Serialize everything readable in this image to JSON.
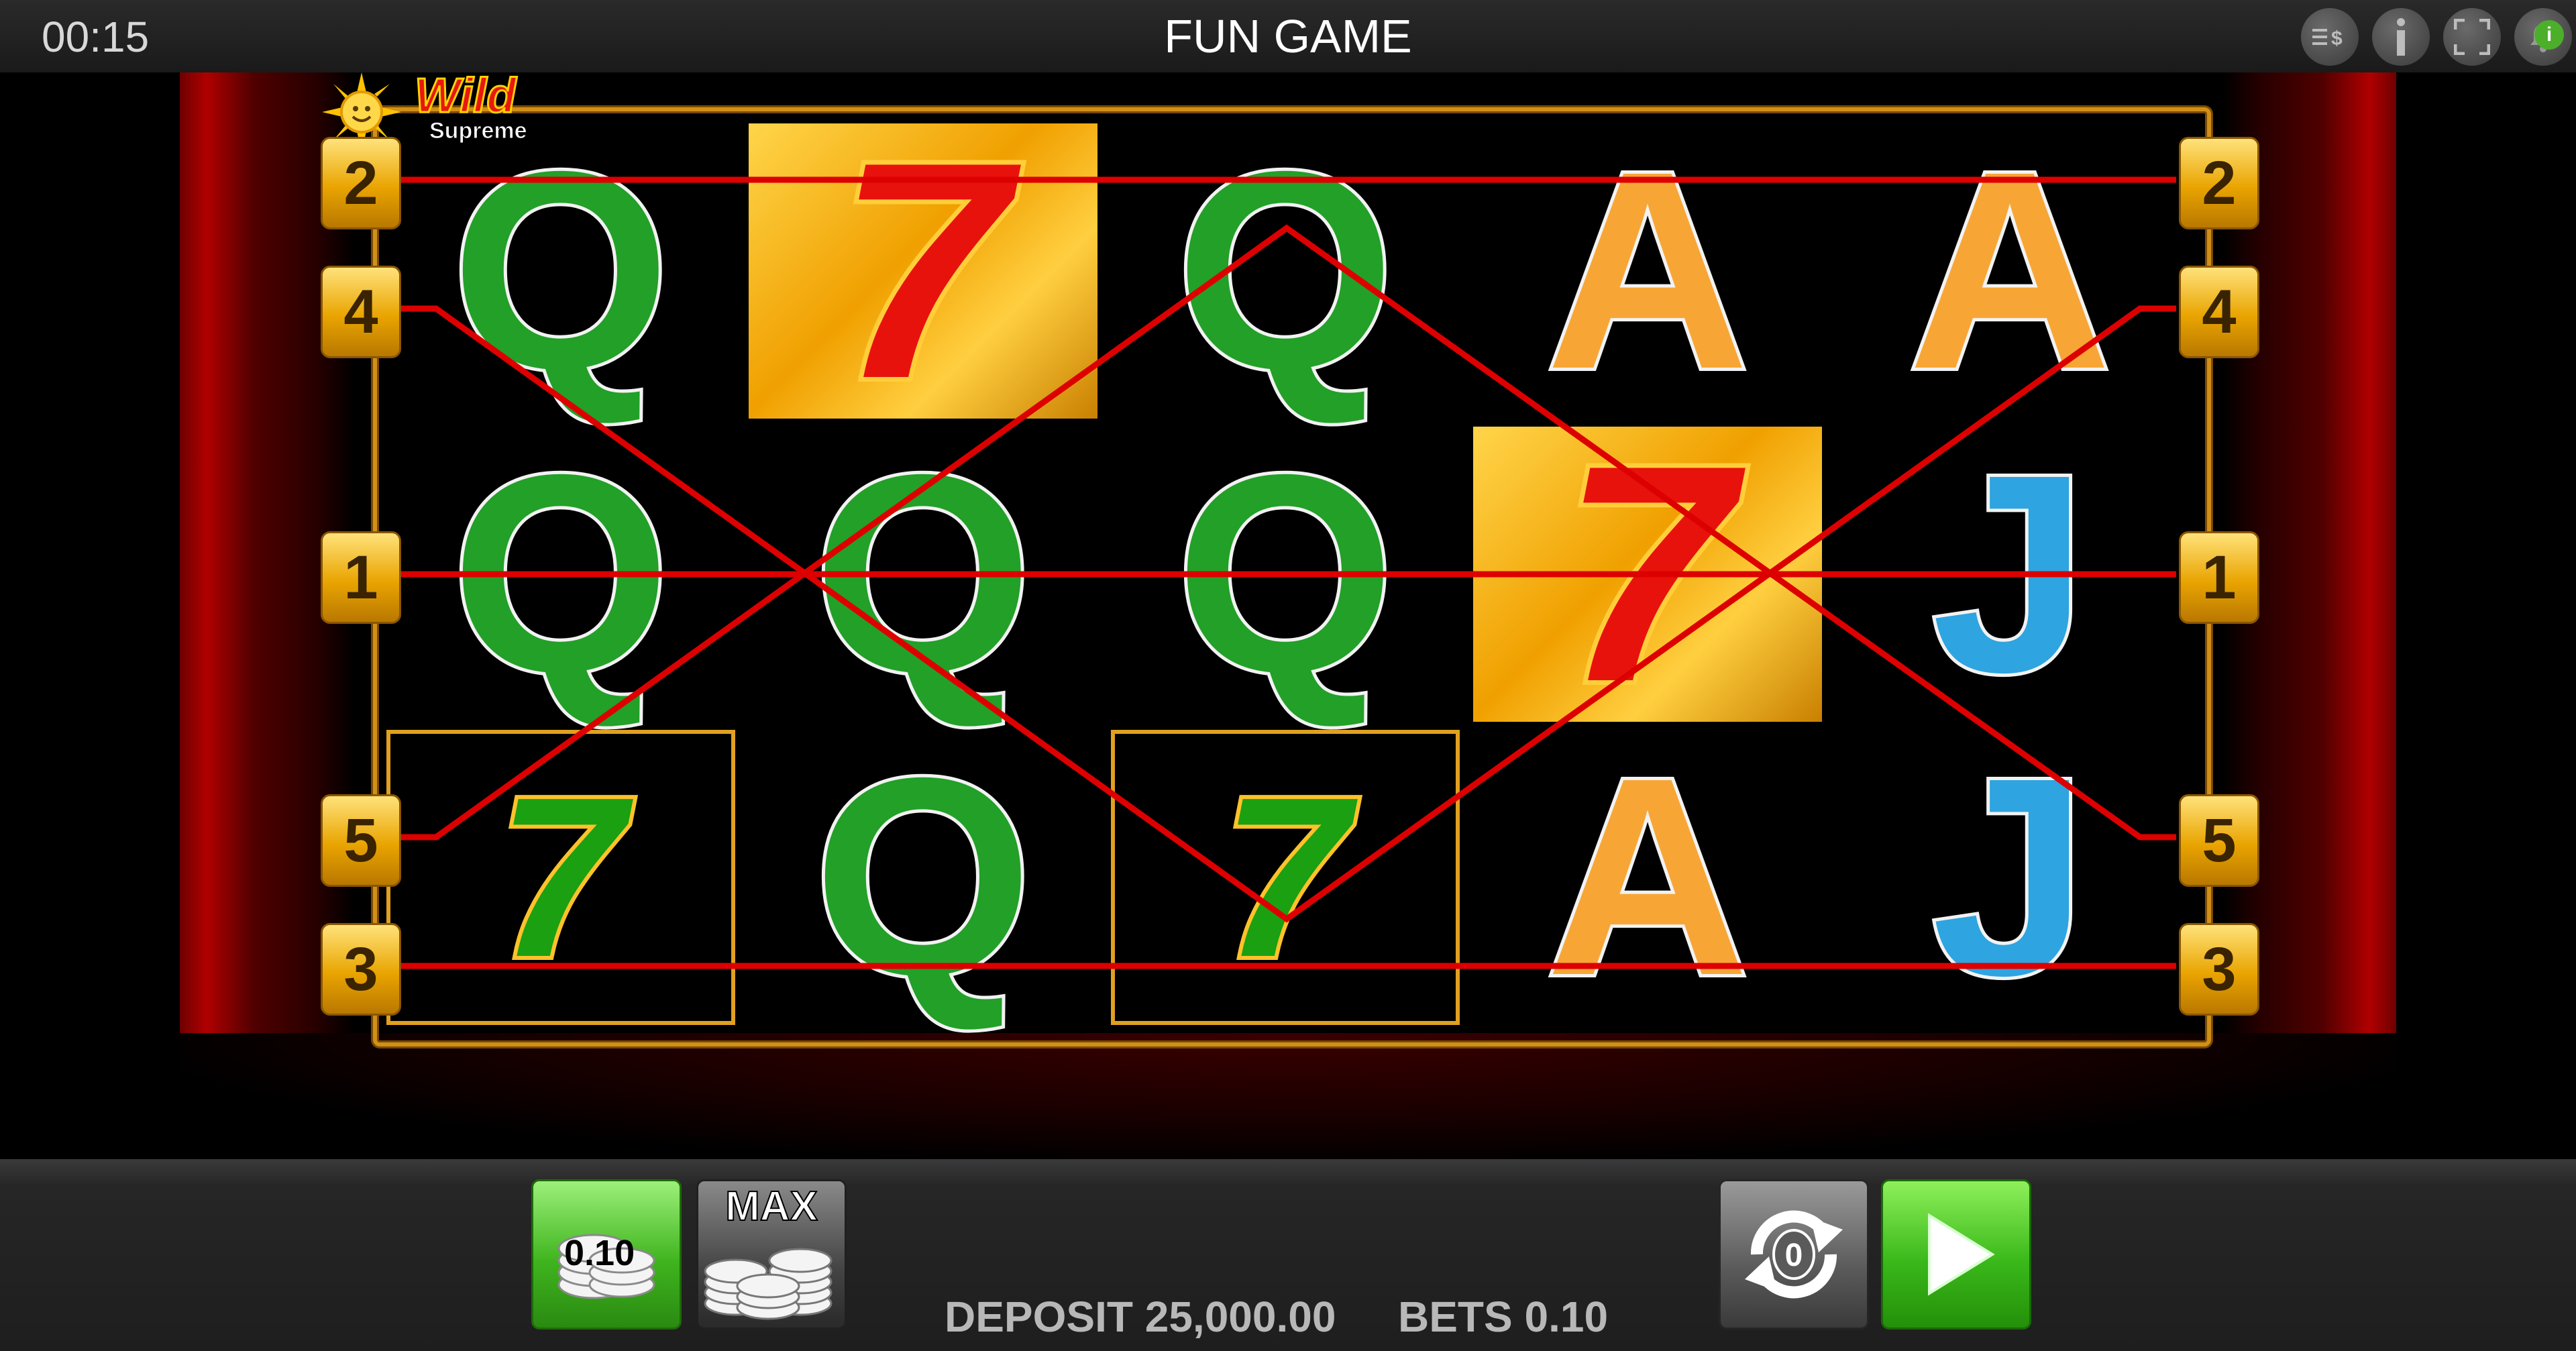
{
  "header": {
    "clock": "00:15",
    "title": "FUN GAME",
    "icons": [
      "balance-menu-icon",
      "info-icon",
      "fullscreen-icon",
      "notification-icon"
    ],
    "notification_badge": "i"
  },
  "logo": {
    "wild": "Wild",
    "supreme": "Supreme"
  },
  "reels": [
    [
      "Q",
      "Q",
      "7"
    ],
    [
      "7",
      "Q",
      "Q"
    ],
    [
      "Q",
      "Q",
      "7"
    ],
    [
      "A",
      "7",
      "A"
    ],
    [
      "A",
      "J",
      "J"
    ]
  ],
  "winning_positions": [
    [
      1,
      0
    ],
    [
      3,
      1
    ]
  ],
  "highlighted_positions": [
    [
      0,
      2
    ],
    [
      2,
      2
    ]
  ],
  "seven_colors": {
    "gold_cells": "red",
    "highlighted_cells": "green"
  },
  "paylines": {
    "left": [
      "2",
      "4",
      "1",
      "5",
      "3"
    ],
    "right": [
      "2",
      "4",
      "1",
      "5",
      "3"
    ]
  },
  "controls": {
    "coin_value": "0.10",
    "max_label": "MAX",
    "autoplay_count": "0"
  },
  "status": {
    "deposit": "DEPOSIT 25,000.00",
    "bets": "BETS 0.10"
  },
  "colors": {
    "payline": "#dd0000",
    "frame": "#d09018",
    "q": "#22a028",
    "a": "#f7a636",
    "j": "#2ea4e0",
    "spin_button": "#3ab81a"
  }
}
